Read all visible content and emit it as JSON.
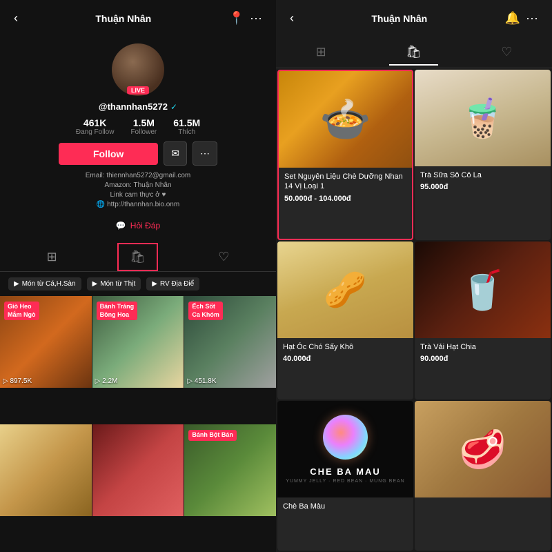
{
  "left": {
    "header": {
      "title": "Thuận Nhân",
      "back_icon": "‹",
      "more_icon": "···",
      "location_icon": "📍"
    },
    "profile": {
      "username": "@thannhan5272",
      "live_label": "LIVE",
      "stats": [
        {
          "value": "461K",
          "label": "Đang Follow"
        },
        {
          "value": "1.5M",
          "label": "Follower"
        },
        {
          "value": "61.5M",
          "label": "Thích"
        }
      ],
      "follow_button": "Follow",
      "message_button": "✉",
      "bio_lines": [
        "Email: thiennhan5272@gmail.com",
        "Amazon: Thuận Nhân",
        "Link cam thực ở ♥",
        "🌐 http://thannhan.bio.onm"
      ],
      "qa_label": "Hỏi Đáp"
    },
    "tabs": [
      {
        "icon": "⊞",
        "id": "videos"
      },
      {
        "icon": "🛍",
        "id": "shop",
        "active": true,
        "selected": true
      },
      {
        "icon": "♡",
        "id": "liked"
      }
    ],
    "filters": [
      {
        "icon": "▶",
        "label": "Món từ Cá,H.Sàn"
      },
      {
        "icon": "▶",
        "label": "Món từ Thịt"
      },
      {
        "icon": "▶",
        "label": "RV Địa Điể"
      }
    ],
    "videos": [
      {
        "label": "Giò Heo\nMắm Ngò",
        "views": "897.5K",
        "color": "food-1"
      },
      {
        "label": "Bánh Tráng\nBông Hoa",
        "views": "2.2M",
        "color": "food-2"
      },
      {
        "label": "Ếch Sốt\nCa Khóm",
        "views": "451.8K",
        "color": "food-3"
      },
      {
        "label": "",
        "views": "",
        "color": "food-4"
      },
      {
        "label": "",
        "views": "",
        "color": "food-5"
      },
      {
        "label": "Bánh Bột Bán",
        "views": "",
        "color": "food-6"
      }
    ]
  },
  "right": {
    "header": {
      "title": "Thuận Nhân",
      "back_icon": "‹",
      "bell_icon": "🔔",
      "more_icon": "···"
    },
    "tabs": [
      {
        "icon": "⊞",
        "id": "all"
      },
      {
        "icon": "🛍",
        "id": "shop",
        "active": true
      },
      {
        "icon": "♡",
        "id": "liked"
      }
    ],
    "products": [
      {
        "id": "p1",
        "name": "Set Nguyên Liệu Chè Dưỡng Nhan 14 Vị Loại 1",
        "price": "50.000đ - 104.000đ",
        "img_type": "soup",
        "highlighted": true
      },
      {
        "id": "p2",
        "name": "Trà Sữa Sô Cô La",
        "price": "95.000đ",
        "img_type": "milk-tea",
        "highlighted": false
      },
      {
        "id": "p3",
        "name": "Hạt Óc Chó Sấy Khô",
        "price": "40.000đ",
        "img_type": "nuts",
        "highlighted": false
      },
      {
        "id": "p4",
        "name": "Trà Vải Hạt Chia",
        "price": "90.000đ",
        "img_type": "tea",
        "highlighted": false
      },
      {
        "id": "p5",
        "name": "Chè Ba Màu",
        "price": "",
        "img_type": "che-ba-mau",
        "highlighted": false
      },
      {
        "id": "p6",
        "name": "",
        "price": "",
        "img_type": "meat",
        "highlighted": false
      }
    ]
  }
}
